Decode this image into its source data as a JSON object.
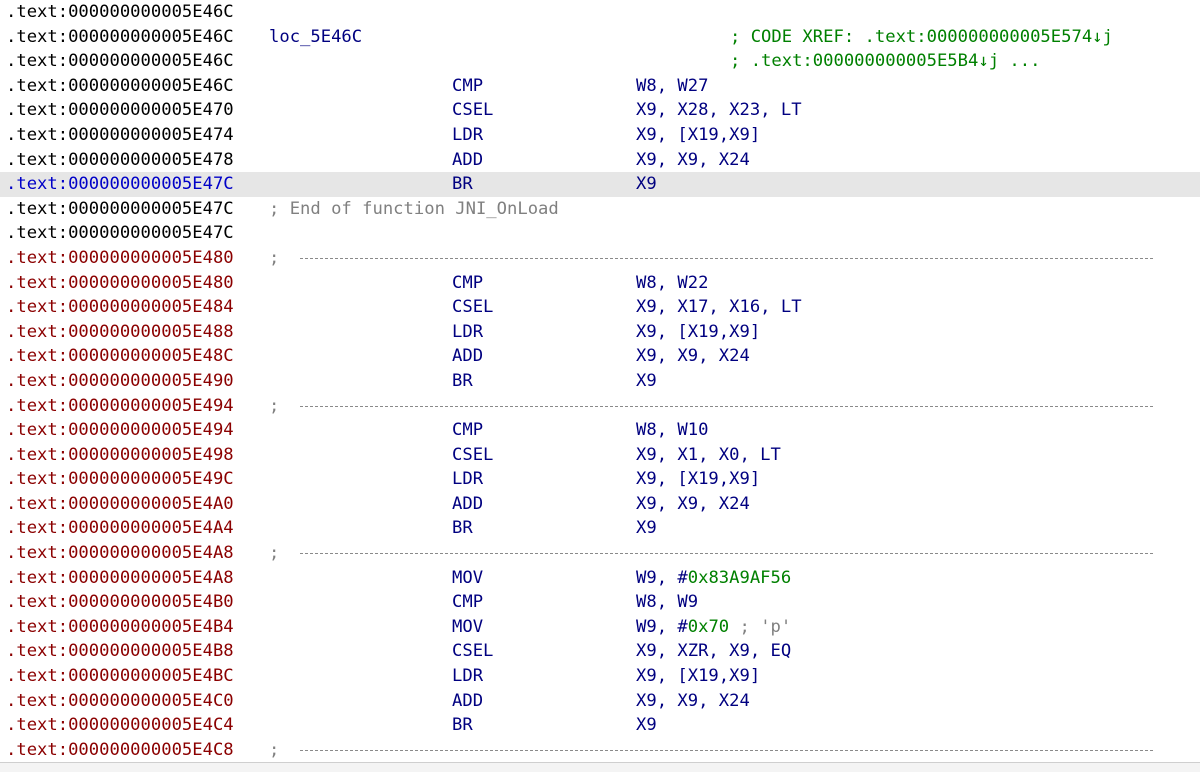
{
  "listing": [
    {
      "kind": "blank",
      "addr": ".text:000000000005E46C",
      "addr_color": "black"
    },
    {
      "kind": "label",
      "addr": ".text:000000000005E46C",
      "addr_color": "black",
      "label": "loc_5E46C",
      "xref": "; CODE XREF: .text:000000000005E574↓j"
    },
    {
      "kind": "xref",
      "addr": ".text:000000000005E46C",
      "addr_color": "black",
      "xref": "; .text:000000000005E5B4↓j ..."
    },
    {
      "kind": "insn",
      "addr": ".text:000000000005E46C",
      "addr_color": "black",
      "mnem": "CMP",
      "ops": "W8, W27"
    },
    {
      "kind": "insn",
      "addr": ".text:000000000005E470",
      "addr_color": "black",
      "mnem": "CSEL",
      "ops": "X9, X28, X23, LT"
    },
    {
      "kind": "insn",
      "addr": ".text:000000000005E474",
      "addr_color": "black",
      "mnem": "LDR",
      "ops": "X9, [X19,X9]"
    },
    {
      "kind": "insn",
      "addr": ".text:000000000005E478",
      "addr_color": "black",
      "mnem": "ADD",
      "ops": "X9, X9, X24"
    },
    {
      "kind": "insn",
      "addr": ".text:000000000005E47C",
      "addr_color": "blue",
      "mnem": "BR",
      "ops": "X9",
      "highlight": true
    },
    {
      "kind": "endfn",
      "addr": ".text:000000000005E47C",
      "addr_color": "black",
      "text": "; End of function JNI_OnLoad"
    },
    {
      "kind": "blank",
      "addr": ".text:000000000005E47C",
      "addr_color": "black"
    },
    {
      "kind": "sep",
      "addr": ".text:000000000005E480",
      "addr_color": "red",
      "text": ";"
    },
    {
      "kind": "insn",
      "addr": ".text:000000000005E480",
      "addr_color": "red",
      "mnem": "CMP",
      "ops": "W8, W22"
    },
    {
      "kind": "insn",
      "addr": ".text:000000000005E484",
      "addr_color": "red",
      "mnem": "CSEL",
      "ops": "X9, X17, X16, LT"
    },
    {
      "kind": "insn",
      "addr": ".text:000000000005E488",
      "addr_color": "red",
      "mnem": "LDR",
      "ops": "X9, [X19,X9]"
    },
    {
      "kind": "insn",
      "addr": ".text:000000000005E48C",
      "addr_color": "red",
      "mnem": "ADD",
      "ops": "X9, X9, X24"
    },
    {
      "kind": "insn",
      "addr": ".text:000000000005E490",
      "addr_color": "red",
      "mnem": "BR",
      "ops": "X9"
    },
    {
      "kind": "sep",
      "addr": ".text:000000000005E494",
      "addr_color": "red",
      "text": ";"
    },
    {
      "kind": "insn",
      "addr": ".text:000000000005E494",
      "addr_color": "red",
      "mnem": "CMP",
      "ops": "W8, W10"
    },
    {
      "kind": "insn",
      "addr": ".text:000000000005E498",
      "addr_color": "red",
      "mnem": "CSEL",
      "ops": "X9, X1, X0, LT"
    },
    {
      "kind": "insn",
      "addr": ".text:000000000005E49C",
      "addr_color": "red",
      "mnem": "LDR",
      "ops": "X9, [X19,X9]"
    },
    {
      "kind": "insn",
      "addr": ".text:000000000005E4A0",
      "addr_color": "red",
      "mnem": "ADD",
      "ops": "X9, X9, X24"
    },
    {
      "kind": "insn",
      "addr": ".text:000000000005E4A4",
      "addr_color": "red",
      "mnem": "BR",
      "ops": "X9"
    },
    {
      "kind": "sep",
      "addr": ".text:000000000005E4A8",
      "addr_color": "red",
      "text": ";"
    },
    {
      "kind": "insn",
      "addr": ".text:000000000005E4A8",
      "addr_color": "red",
      "mnem": "MOV",
      "ops_pre": "W9, #",
      "ops_num": "0x83A9AF56"
    },
    {
      "kind": "insn",
      "addr": ".text:000000000005E4B0",
      "addr_color": "red",
      "mnem": "CMP",
      "ops": "W8, W9"
    },
    {
      "kind": "insn",
      "addr": ".text:000000000005E4B4",
      "addr_color": "red",
      "mnem": "MOV",
      "ops_pre": "W9, #",
      "ops_num": "0x70",
      "ops_cmt": " ; 'p'"
    },
    {
      "kind": "insn",
      "addr": ".text:000000000005E4B8",
      "addr_color": "red",
      "mnem": "CSEL",
      "ops": "X9, XZR, X9, EQ"
    },
    {
      "kind": "insn",
      "addr": ".text:000000000005E4BC",
      "addr_color": "red",
      "mnem": "LDR",
      "ops": "X9, [X19,X9]"
    },
    {
      "kind": "insn",
      "addr": ".text:000000000005E4C0",
      "addr_color": "red",
      "mnem": "ADD",
      "ops": "X9, X9, X24"
    },
    {
      "kind": "insn",
      "addr": ".text:000000000005E4C4",
      "addr_color": "red",
      "mnem": "BR",
      "ops": "X9"
    },
    {
      "kind": "sep",
      "addr": ".text:000000000005E4C8",
      "addr_color": "red",
      "text": ";"
    }
  ],
  "status_bar": {
    "text": ""
  }
}
